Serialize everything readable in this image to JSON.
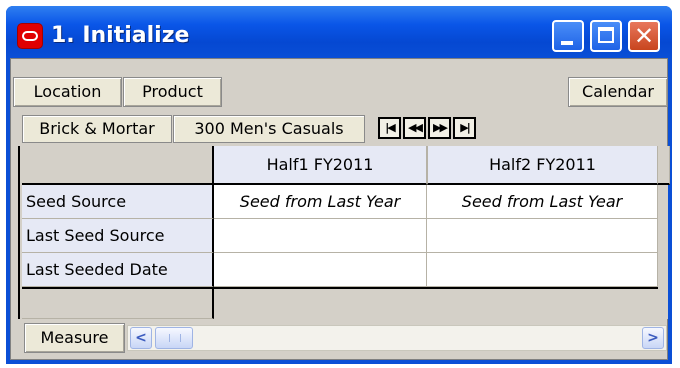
{
  "window": {
    "title": "1. Initialize",
    "icons": {
      "logo": "oracle-logo-icon",
      "minimize": "minimize-icon",
      "maximize": "maximize-icon",
      "close": "close-icon"
    },
    "close_glyph": "✕"
  },
  "toolbar": {
    "location_label": "Location",
    "product_label": "Product",
    "calendar_label": "Calendar"
  },
  "pov": {
    "items": [
      "Brick & Mortar",
      "300 Men's Casuals"
    ],
    "nav": {
      "first": "|◀",
      "prev": "◀◀",
      "next": "▶▶",
      "last": "▶|"
    }
  },
  "grid": {
    "columns": [
      "Half1 FY2011",
      "Half2 FY2011"
    ],
    "rows": [
      {
        "label": "Seed Source",
        "values": [
          "Seed from Last Year",
          "Seed from Last Year"
        ]
      },
      {
        "label": "Last Seed Source",
        "values": [
          "",
          ""
        ]
      },
      {
        "label": "Last Seeded Date",
        "values": [
          "",
          ""
        ]
      }
    ]
  },
  "footer": {
    "measure_label": "Measure",
    "scroll_left": "<",
    "scroll_right": ">"
  },
  "colors": {
    "titlebar": "#0a4fd6",
    "header_bg": "#e6e9f5",
    "panel_bg": "#d4d0c8",
    "close_button": "#c8451e"
  }
}
